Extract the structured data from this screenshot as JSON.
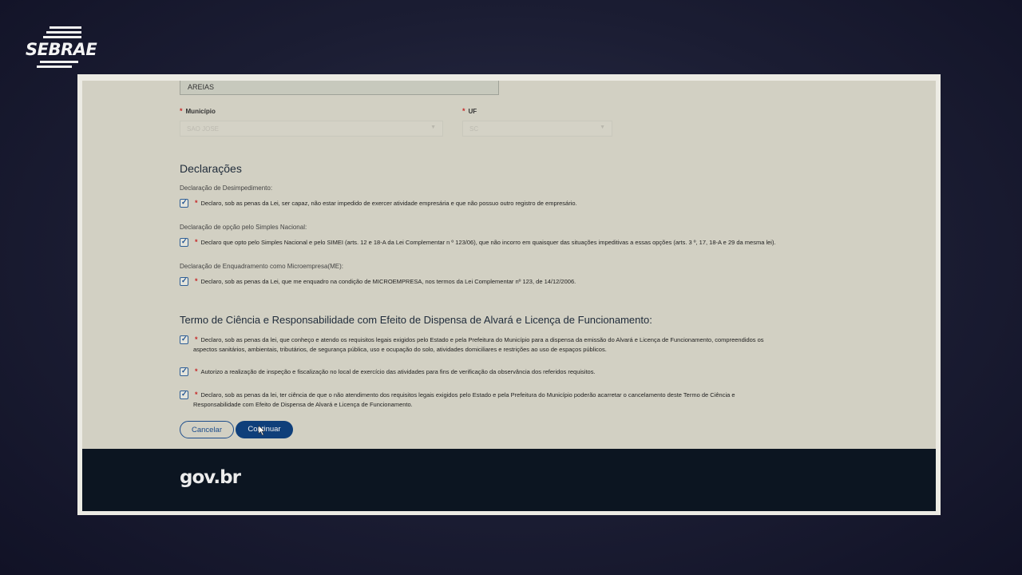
{
  "brand": {
    "logo_text": "SEBRAE"
  },
  "form": {
    "bairro_value": "AREIAS",
    "municipio": {
      "label": "Município",
      "value": "SAO JOSE"
    },
    "uf": {
      "label": "UF",
      "value": "SC"
    }
  },
  "declaracoes": {
    "title": "Declarações",
    "groups": [
      {
        "subtitle": "Declaração de Desimpedimento:",
        "text": "Declaro, sob as penas da Lei, ser capaz, não estar impedido de exercer atividade empresária e que não possuo outro registro de empresário.",
        "checked": true
      },
      {
        "subtitle": "Declaração de opção pelo Simples Nacional:",
        "text": "Declaro que opto pelo Simples Nacional e pelo SIMEI (arts. 12 e 18-A da Lei Complementar n º 123/06), que não incorro em quaisquer das situações impeditivas a essas opções (arts. 3 º, 17, 18-A e 29 da mesma lei).",
        "checked": true
      },
      {
        "subtitle": "Declaração de Enquadramento como Microempresa(ME):",
        "text": "Declaro, sob as penas da Lei, que me enquadro na condição de MICROEMPRESA, nos termos da Lei Complementar nº 123, de 14/12/2006.",
        "checked": true
      }
    ]
  },
  "termo": {
    "title": "Termo de Ciência e Responsabilidade com Efeito de Dispensa de Alvará e Licença de Funcionamento:",
    "items": [
      {
        "line1": "Declaro, sob as penas da lei, que conheço e atendo os requisitos legais exigidos pelo Estado e pela Prefeitura do Município para a dispensa da emissão do Alvará e Licença de Funcionamento, compreendidos os",
        "line2": "aspectos sanitários, ambientais, tributários, de segurança pública, uso e ocupação do solo, atividades domiciliares e restrições ao uso de espaços públicos.",
        "checked": true
      },
      {
        "line1": "Autorizo a realização de inspeção e fiscalização no local de exercício das atividades para fins de verificação da observância dos referidos requisitos.",
        "line2": "",
        "checked": true
      },
      {
        "line1": "Declaro, sob as penas da lei, ter ciência de que o não atendimento dos requisitos legais exigidos pelo Estado e pela Prefeitura do Município poderão acarretar o cancelamento deste Termo de Ciência e",
        "line2": "Responsabilidade com Efeito de Dispensa de Alvará e Licença de Funcionamento.",
        "checked": true
      }
    ]
  },
  "actions": {
    "cancel_label": "Cancelar",
    "continue_label": "Continuar"
  },
  "footer": {
    "logo_text": "gov.br"
  },
  "icons": {
    "check": "check-icon",
    "required": "asterisk-icon",
    "chevron": "chevron-down-icon"
  },
  "colors": {
    "primary": "#0f3f7a",
    "required": "#c62828",
    "footer": "#0c1521"
  }
}
